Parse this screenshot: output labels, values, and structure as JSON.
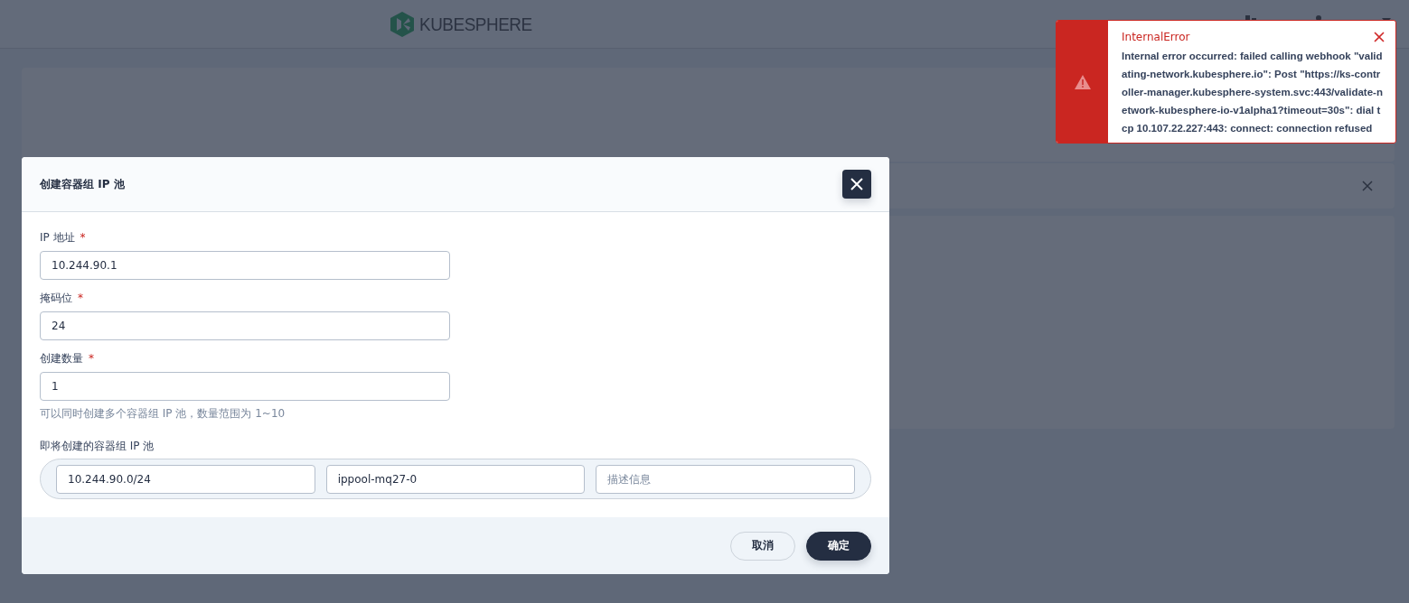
{
  "header": {
    "logo": "KUBESPHERE"
  },
  "dialog": {
    "title": "创建容器组 IP 池",
    "fields": [
      {
        "label": "IP 地址",
        "required_mark": "*",
        "value": "10.244.90.1"
      },
      {
        "label": "掩码位",
        "required_mark": "*",
        "value": "24"
      },
      {
        "label": "创建数量",
        "required_mark": "*",
        "value": "1",
        "hint": "可以同时创建多个容器组 IP 池，数量范围为 1~10"
      }
    ],
    "pool_section": {
      "label": "即将创建的容器组 IP 池",
      "items": [
        {
          "value": "10.244.90.0/24"
        },
        {
          "value": "ippool-mq27-0"
        },
        {
          "placeholder": "描述信息"
        }
      ]
    },
    "buttons": [
      {
        "label": "取消",
        "kind": "secondary"
      },
      {
        "label": "确定",
        "kind": "primary"
      }
    ]
  },
  "toast": {
    "title": "InternalError",
    "message": "Internal error occurred: failed calling webhook \"validating-network.kubesphere.io\": Post \"https://ks-controller-manager.kubesphere-system.svc:443/validate-network-kubesphere-io-v1alpha1?timeout=30s\": dial tcp 10.107.22.227:443: connect: connection refused"
  }
}
